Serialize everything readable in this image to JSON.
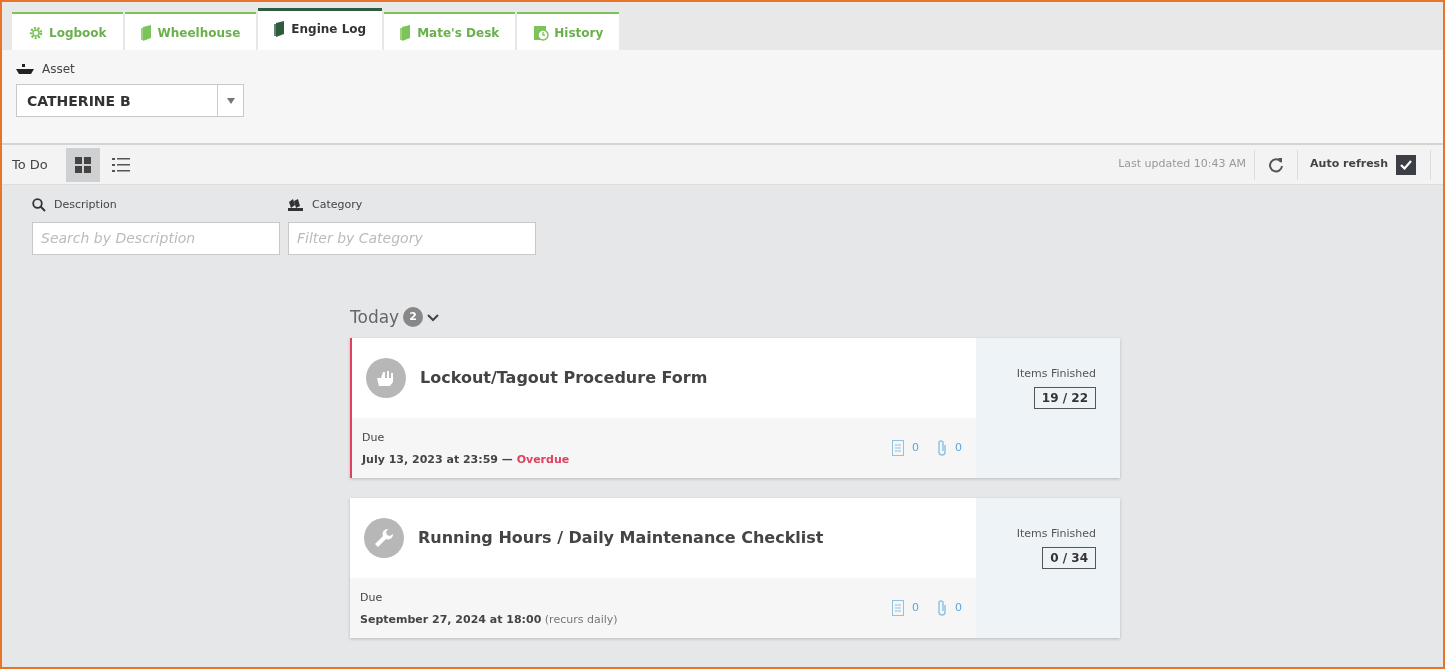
{
  "tabs": [
    {
      "label": "Logbook",
      "kind": "gear",
      "selected": false
    },
    {
      "label": "Wheelhouse",
      "kind": "book",
      "selected": false
    },
    {
      "label": "Engine Log",
      "kind": "book",
      "selected": true
    },
    {
      "label": "Mate's Desk",
      "kind": "book",
      "selected": false
    },
    {
      "label": "History",
      "kind": "history",
      "selected": false
    }
  ],
  "asset": {
    "label": "Asset",
    "value": "CATHERINE B"
  },
  "toolbar": {
    "title": "To Do",
    "views": [
      {
        "kind": "grid",
        "selected": true
      },
      {
        "kind": "list",
        "selected": false
      }
    ],
    "last_updated": "Last updated 10:43 AM",
    "auto_refresh": {
      "label": "Auto refresh",
      "checked": true
    }
  },
  "filters": [
    {
      "kind": "search",
      "label": "Description",
      "placeholder": "Search by Description"
    },
    {
      "kind": "category",
      "label": "Category",
      "placeholder": "Filter by Category"
    }
  ],
  "group": {
    "title": "Today",
    "count": "2",
    "expanded": true
  },
  "tasks": [
    {
      "kind": "hands",
      "title": "Lockout/Tagout Procedure Form",
      "due_label": "Due",
      "due": "July 13, 2023 at 23:59 —",
      "status": "Overdue",
      "overdue": true,
      "notes": "0",
      "attachments": "0",
      "items_label": "Items Finished",
      "items": "19 / 22"
    },
    {
      "kind": "wrench",
      "title": "Running Hours / Daily Maintenance Checklist",
      "due_label": "Due",
      "due": "September 27, 2024 at 18:00",
      "note": "(recurs daily)",
      "overdue": false,
      "notes": "0",
      "attachments": "0",
      "items_label": "Items Finished",
      "items": "0 / 34"
    }
  ]
}
